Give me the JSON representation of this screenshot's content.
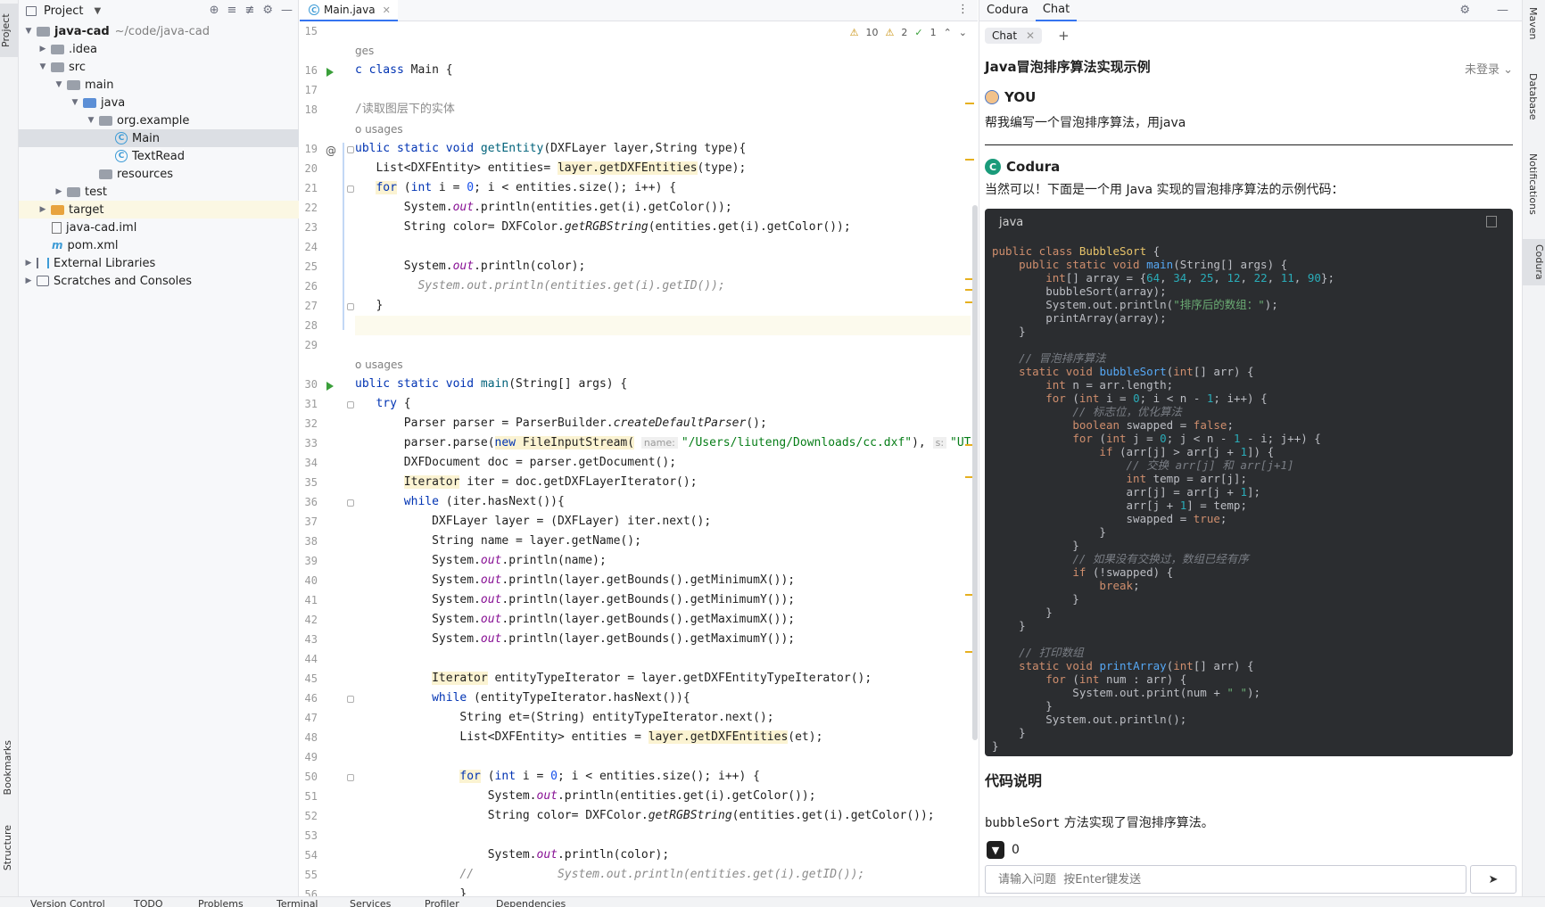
{
  "left_strip": {
    "project": "Project",
    "bookmarks": "Bookmarks",
    "structure": "Structure"
  },
  "project_panel": {
    "title": "Project",
    "tree": [
      {
        "label": "java-cad",
        "extra": "~/code/java-cad"
      },
      {
        "label": ".idea"
      },
      {
        "label": "src"
      },
      {
        "label": "main"
      },
      {
        "label": "java"
      },
      {
        "label": "org.example"
      },
      {
        "label": "Main"
      },
      {
        "label": "TextRead"
      },
      {
        "label": "resources"
      },
      {
        "label": "test"
      },
      {
        "label": "target"
      },
      {
        "label": "java-cad.iml"
      },
      {
        "label": "pom.xml"
      },
      {
        "label": "External Libraries"
      },
      {
        "label": "Scratches and Consoles"
      }
    ]
  },
  "editor": {
    "tab": "Main.java",
    "inspections": {
      "warnings": "10",
      "weak_warnings": "2",
      "ok": "1"
    },
    "hints": {
      "usages_partial": "ges",
      "no_usages": "o usages",
      "param_name": "name:",
      "param_s": "s:"
    },
    "line_numbers": [
      "15",
      "16",
      "17",
      "18",
      "19",
      "20",
      "21",
      "22",
      "23",
      "24",
      "25",
      "26",
      "27",
      "28",
      "29",
      "30",
      "31",
      "32",
      "33",
      "34",
      "35",
      "36",
      "37",
      "38",
      "39",
      "40",
      "41",
      "42",
      "43",
      "44",
      "45",
      "46",
      "47",
      "48",
      "49",
      "50",
      "51",
      "52",
      "53",
      "54",
      "55",
      "56"
    ],
    "comment_18": "/读取图层下的实体",
    "path_string": "\"/Users/liuteng/Downloads/cc.dxf\"",
    "ut_string": "\"UT"
  },
  "chat_panel": {
    "top_tabs": [
      "Codura",
      "Chat"
    ],
    "sub_tab": "Chat",
    "conversation_title": "Java冒泡排序算法实现示例",
    "login_status": "未登录",
    "user_name": "YOU",
    "user_message": "帮我编写一个冒泡排序算法，用java",
    "bot_name": "Codura",
    "bot_message": "当然可以！下面是一个用 Java 实现的冒泡排序算法的示例代码：",
    "code_lang": "java",
    "code_string": "\"排序后的数组：\"",
    "code_comments": {
      "bubble": "// 冒泡排序算法",
      "flag": "// 标志位，优化算法",
      "swap": "// 交换 arr[j] 和 arr[j+1]",
      "sorted": "// 如果没有交换过，数组已经有序",
      "print": "// 打印数组"
    },
    "explain_title": "代码说明",
    "explain_method": "bubbleSort",
    "explain_text": " 方法实现了冒泡排序算法。",
    "vote_count": "0",
    "input_placeholder": "请输入问题  按Enter键发送"
  },
  "right_strip": {
    "maven": "Maven",
    "database": "Database",
    "notifications": "Notifications",
    "codura": "Codura"
  },
  "bottom_bar": [
    "Version Control",
    "TODO",
    "Problems",
    "Terminal",
    "Services",
    "Profiler",
    "Dependencies"
  ],
  "icons": {
    "run": "run-icon",
    "override": "override-icon",
    "gear": "gear-icon",
    "minimize": "minimize-icon",
    "send": "send-icon",
    "copy": "copy-icon"
  }
}
